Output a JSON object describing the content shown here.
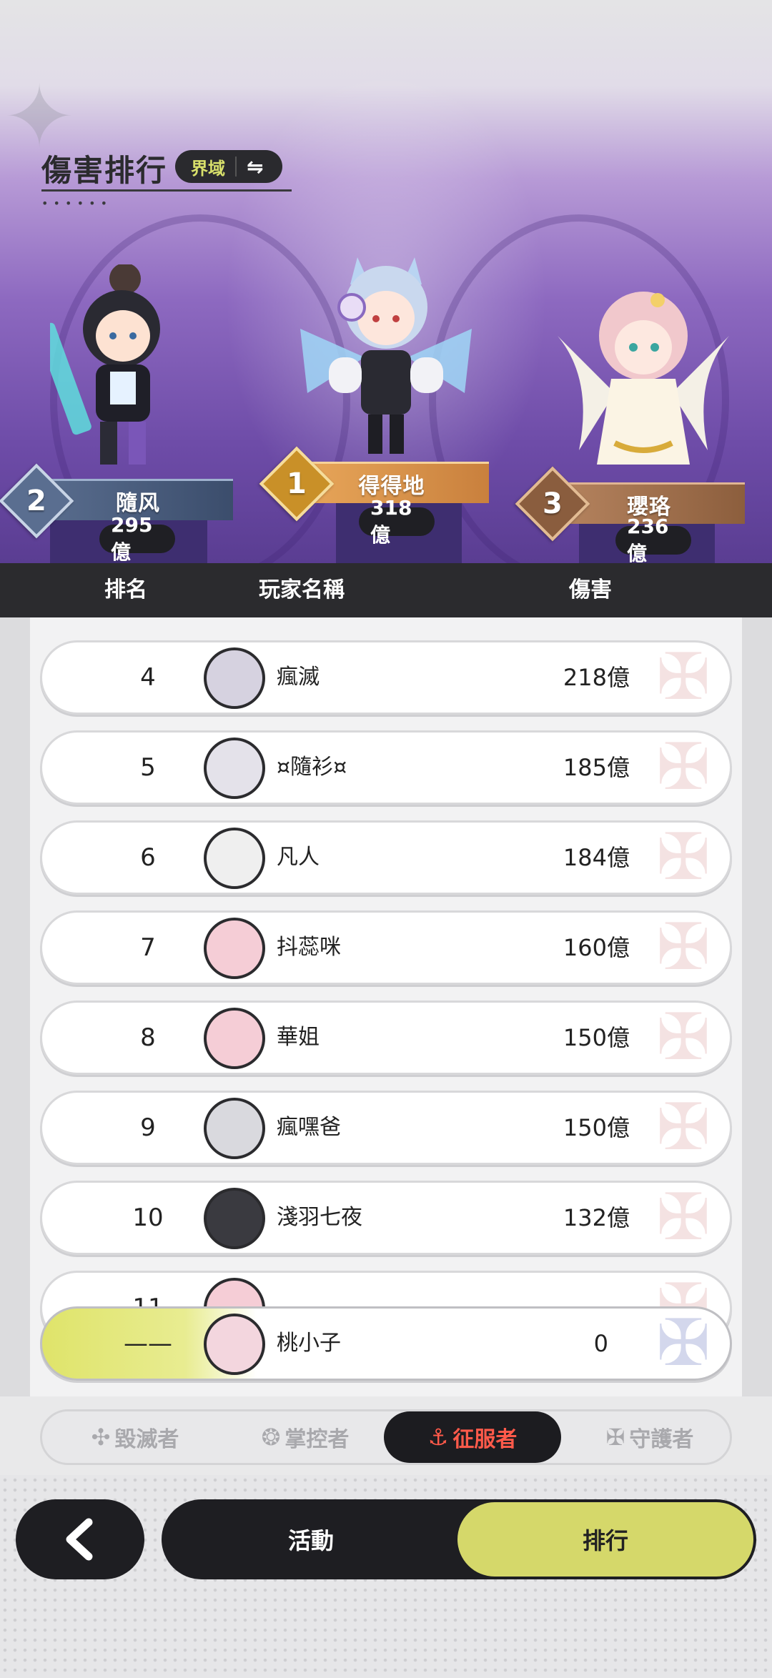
{
  "header": {
    "title": "傷害排行",
    "realm_toggle": "界域",
    "swap_icon": "⇋"
  },
  "podium": [
    {
      "rank": "1",
      "name": "得得地",
      "score": "318億"
    },
    {
      "rank": "2",
      "name": "隨风",
      "score": "295億"
    },
    {
      "rank": "3",
      "name": "瓔珞",
      "score": "236億"
    }
  ],
  "table": {
    "col_rank": "排名",
    "col_player": "玩家名稱",
    "col_damage": "傷害"
  },
  "rows": [
    {
      "rank": "4",
      "name": "瘋滅",
      "damage": "218億"
    },
    {
      "rank": "5",
      "name": "¤隨衫¤",
      "damage": "185億"
    },
    {
      "rank": "6",
      "name": "凡人",
      "damage": "184億"
    },
    {
      "rank": "7",
      "name": "抖蕊咪",
      "damage": "160億"
    },
    {
      "rank": "8",
      "name": "華姐",
      "damage": "150億"
    },
    {
      "rank": "9",
      "name": "瘋嘿爸",
      "damage": "150億"
    },
    {
      "rank": "10",
      "name": "淺羽七夜",
      "damage": "132億"
    },
    {
      "rank": "11",
      "name": "",
      "damage": ""
    }
  ],
  "self_row": {
    "rank": "——",
    "name": "桃小子",
    "damage": "0"
  },
  "categories": [
    {
      "label": "毀滅者",
      "icon": "destroyer-icon"
    },
    {
      "label": "掌控者",
      "icon": "controller-icon"
    },
    {
      "label": "征服者",
      "icon": "conqueror-icon",
      "active": true
    },
    {
      "label": "守護者",
      "icon": "guardian-icon"
    }
  ],
  "nav": {
    "activity": "活動",
    "ranking": "排行"
  },
  "colors": {
    "accent_yellow": "#d5d86a",
    "active_red": "#ff5a4a",
    "dark": "#1e1e22"
  }
}
